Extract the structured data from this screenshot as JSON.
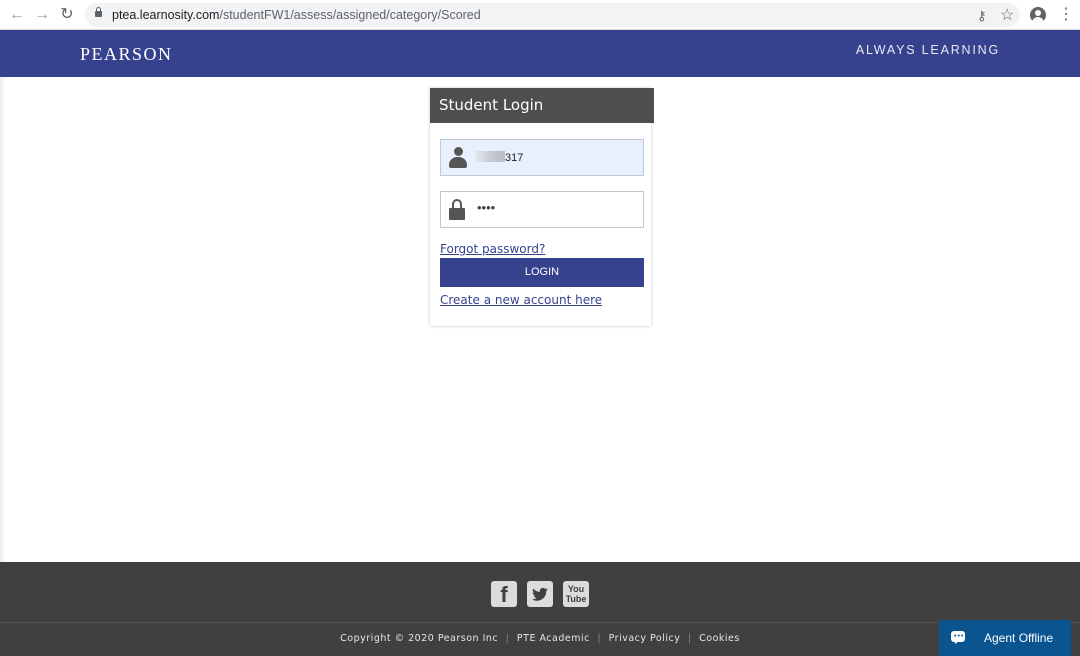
{
  "browser": {
    "url_host": "ptea.learnosity.com",
    "url_path": "/studentFW1/assess/assigned/category/Scored"
  },
  "header": {
    "logo": "PEARSON",
    "tagline": "ALWAYS LEARNING"
  },
  "login": {
    "title": "Student Login",
    "username_value_visible": "317",
    "password_mask": "••••",
    "forgot_password": "Forgot password?",
    "login_button": "LOGIN",
    "create_account": "Create a new account here"
  },
  "footer": {
    "social": {
      "facebook": "f",
      "youtube_top": "You",
      "youtube_bottom": "Tube"
    },
    "copyright": "Copyright © 2020 Pearson Inc",
    "links": [
      "PTE Academic",
      "Privacy Policy",
      "Cookies"
    ]
  },
  "chat": {
    "label": "Agent Offline"
  },
  "colors": {
    "brand": "#37428f",
    "footer": "#404040",
    "chat": "#0a5490"
  }
}
